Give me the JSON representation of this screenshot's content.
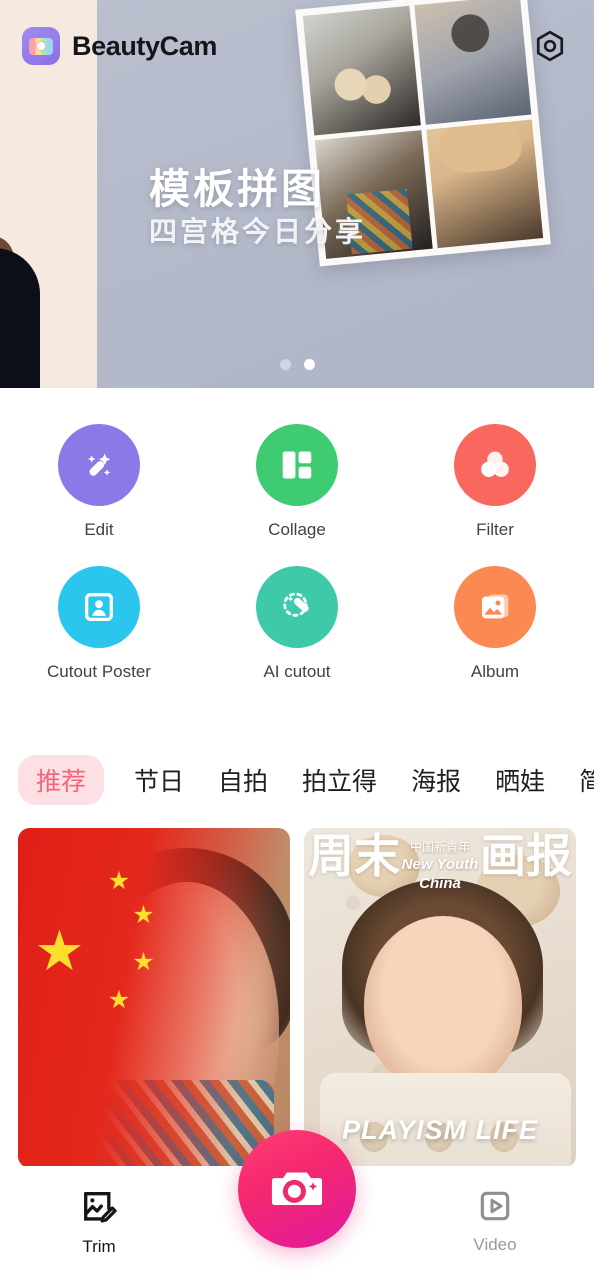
{
  "header": {
    "app_name": "BeautyCam",
    "logo_icon": "camera-app-logo",
    "settings_icon": "hexagon-settings-icon"
  },
  "banner": {
    "title": "模板拼图",
    "subtitle": "四宫格今日分享",
    "dots": [
      {
        "label": "slide-1",
        "active": false
      },
      {
        "label": "slide-2",
        "active": true
      }
    ]
  },
  "tools": {
    "row1": [
      {
        "label": "Edit",
        "icon": "magic-wand-icon",
        "color": "#8a7ae8"
      },
      {
        "label": "Collage",
        "icon": "grid-layout-icon",
        "color": "#3ecb72"
      },
      {
        "label": "Filter",
        "icon": "three-circles-icon",
        "color": "#f9685f"
      }
    ],
    "row2": [
      {
        "label": "Cutout Poster",
        "icon": "portrait-frame-icon",
        "color": "#2ac6ee"
      },
      {
        "label": "AI cutout",
        "icon": "dotted-wand-icon",
        "color": "#3fc9ab"
      },
      {
        "label": "Album",
        "icon": "photo-stack-icon",
        "color": "#fa8a51"
      }
    ]
  },
  "tabs": [
    {
      "label": "推荐",
      "active": true
    },
    {
      "label": "节日",
      "active": false
    },
    {
      "label": "自拍",
      "active": false
    },
    {
      "label": "拍立得",
      "active": false
    },
    {
      "label": "海报",
      "active": false
    },
    {
      "label": "晒娃",
      "active": false
    },
    {
      "label": "简约",
      "active": false
    }
  ],
  "cards": {
    "left": {
      "name": "china-flag-portrait-template"
    },
    "right": {
      "name": "magazine-cover-template",
      "title_left": "周末",
      "title_right": "画报",
      "overline_cn": "中国新青年",
      "overline_en1": "New Youth",
      "overline_en2": "China",
      "bottom_text": "PLAYISM LIFE"
    }
  },
  "bottom_nav": {
    "trim": {
      "label": "Trim",
      "icon": "image-edit-icon",
      "active": true
    },
    "camera": {
      "label": "camera-shutter",
      "icon": "camera-icon"
    },
    "video": {
      "label": "Video",
      "icon": "play-square-icon",
      "active": false
    }
  },
  "colors": {
    "accent_pink": "#f4657c",
    "tab_pill_bg": "#fce0e3",
    "fab_start": "#ff3d75",
    "fab_end": "#e0199c"
  }
}
